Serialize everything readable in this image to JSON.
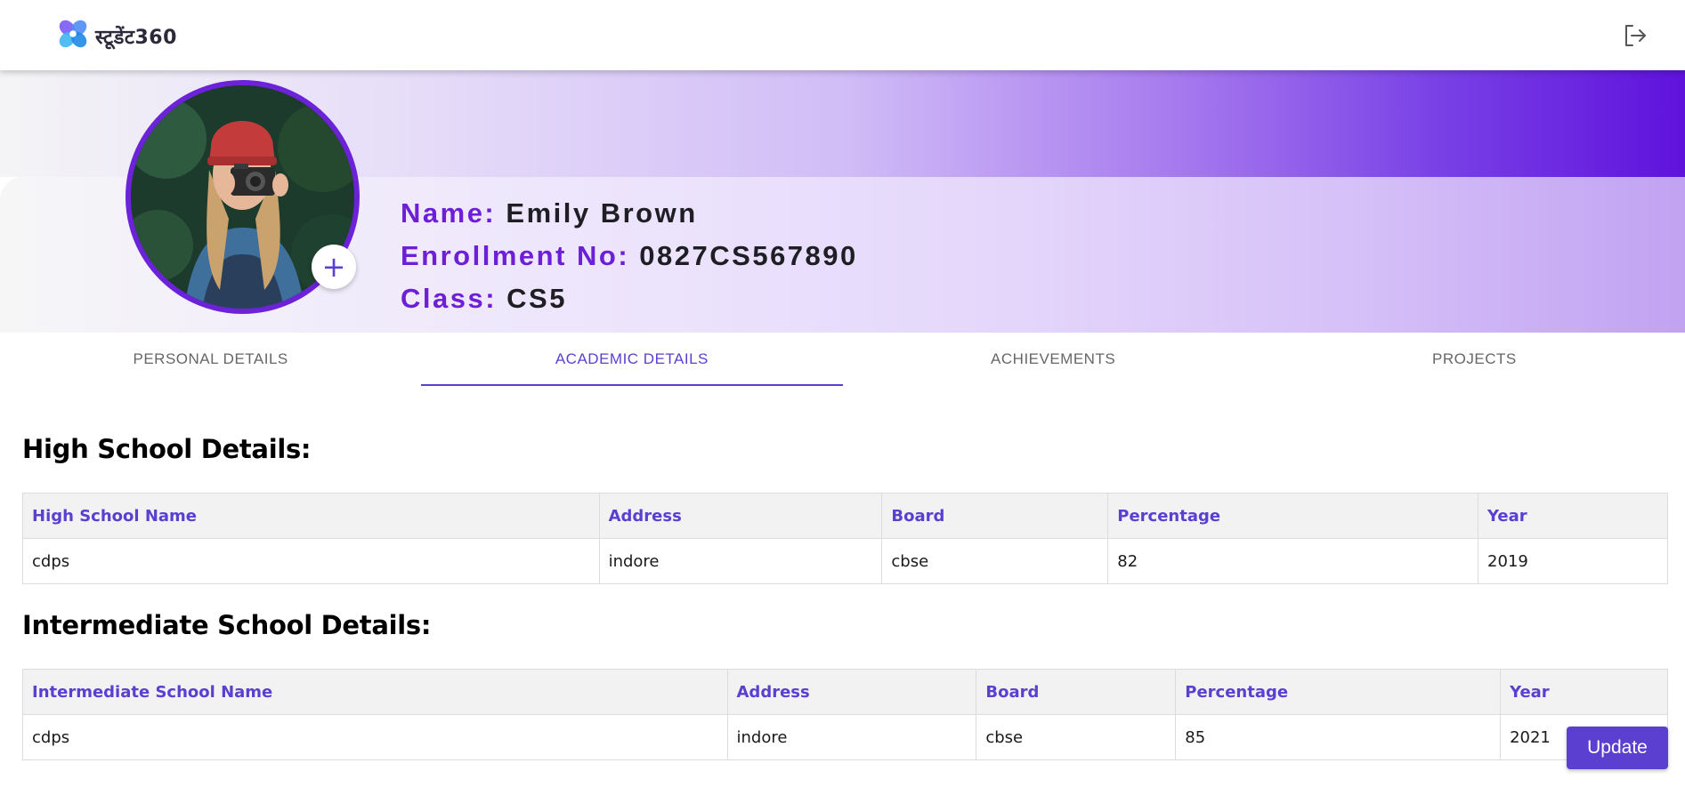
{
  "brand": {
    "name": "स्टूडेंट360"
  },
  "profile": {
    "name_label": "Name:",
    "name_value": "Emily Brown",
    "enrollment_label": "Enrollment No:",
    "enrollment_value": "0827CS567890",
    "class_label": "Class:",
    "class_value": "CS5",
    "add_photo": "+"
  },
  "tabs": [
    {
      "label": "PERSONAL DETAILS",
      "active": false
    },
    {
      "label": "ACADEMIC DETAILS",
      "active": true
    },
    {
      "label": "ACHIEVEMENTS",
      "active": false
    },
    {
      "label": "PROJECTS",
      "active": false
    }
  ],
  "high_school": {
    "title": "High School Details:",
    "headers": [
      "High School Name",
      "Address",
      "Board",
      "Percentage",
      "Year"
    ],
    "rows": [
      [
        "cdps",
        "indore",
        "cbse",
        "82",
        "2019"
      ]
    ]
  },
  "intermediate": {
    "title": "Intermediate School Details:",
    "headers": [
      "Intermediate School Name",
      "Address",
      "Board",
      "Percentage",
      "Year"
    ],
    "rows": [
      [
        "cdps",
        "indore",
        "cbse",
        "85",
        "2021"
      ]
    ]
  },
  "actions": {
    "update_label": "Update"
  },
  "colors": {
    "accent": "#5b3fd1",
    "profile_label": "#6d1fd8",
    "banner_end": "#5f12dc"
  },
  "icons": {
    "logo": "flower-logo-icon",
    "logout": "logout-icon",
    "add_photo": "plus-icon"
  }
}
